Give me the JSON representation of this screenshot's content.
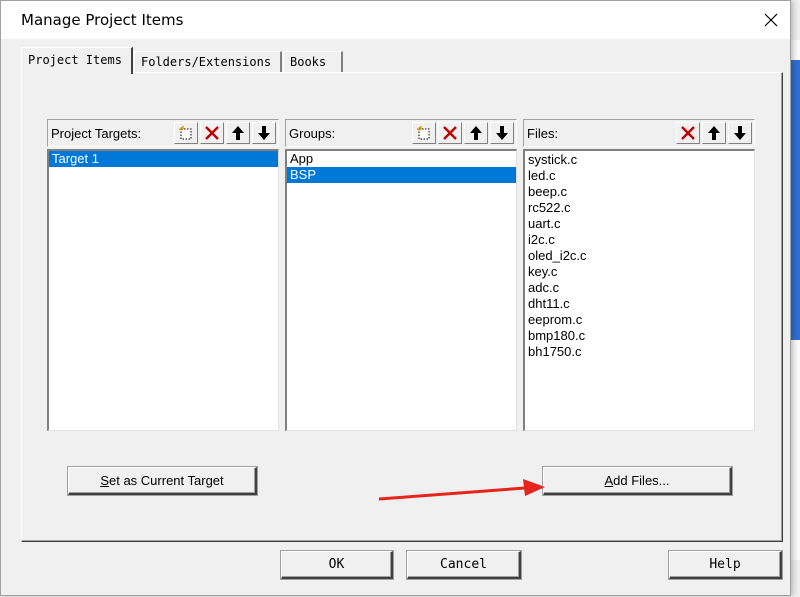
{
  "window": {
    "title": "Manage Project Items",
    "close_glyph": "✕"
  },
  "tabs": [
    {
      "label": "Project Items",
      "active": true
    },
    {
      "label": "Folders/Extensions",
      "active": false
    },
    {
      "label": "Books",
      "active": false
    }
  ],
  "targets_panel": {
    "label": "Project Targets:",
    "tools": [
      "new-icon",
      "delete-icon",
      "move-up-icon",
      "move-down-icon"
    ],
    "items": [
      {
        "label": "Target 1",
        "selected": true
      }
    ]
  },
  "groups_panel": {
    "label": "Groups:",
    "tools": [
      "new-icon",
      "delete-icon",
      "move-up-icon",
      "move-down-icon"
    ],
    "items": [
      {
        "label": "App",
        "selected": false
      },
      {
        "label": "BSP",
        "selected": true
      }
    ]
  },
  "files_panel": {
    "label": "Files:",
    "tools": [
      "delete-icon",
      "move-up-icon",
      "move-down-icon"
    ],
    "items": [
      {
        "label": "systick.c"
      },
      {
        "label": "led.c"
      },
      {
        "label": "beep.c"
      },
      {
        "label": "rc522.c"
      },
      {
        "label": "uart.c"
      },
      {
        "label": "i2c.c"
      },
      {
        "label": "oled_i2c.c"
      },
      {
        "label": "key.c"
      },
      {
        "label": "adc.c"
      },
      {
        "label": "dht11.c"
      },
      {
        "label": "eeprom.c"
      },
      {
        "label": "bmp180.c"
      },
      {
        "label": "bh1750.c"
      }
    ]
  },
  "buttons": {
    "set_target_underline": "S",
    "set_target_rest": "et as Current Target",
    "add_files_underline": "A",
    "add_files_rest": "dd Files...",
    "ok": "OK",
    "cancel": "Cancel",
    "help": "Help"
  },
  "colors": {
    "selection": "#0078d7",
    "delete_red": "#c00000",
    "annotation_arrow": "#e8231b"
  }
}
